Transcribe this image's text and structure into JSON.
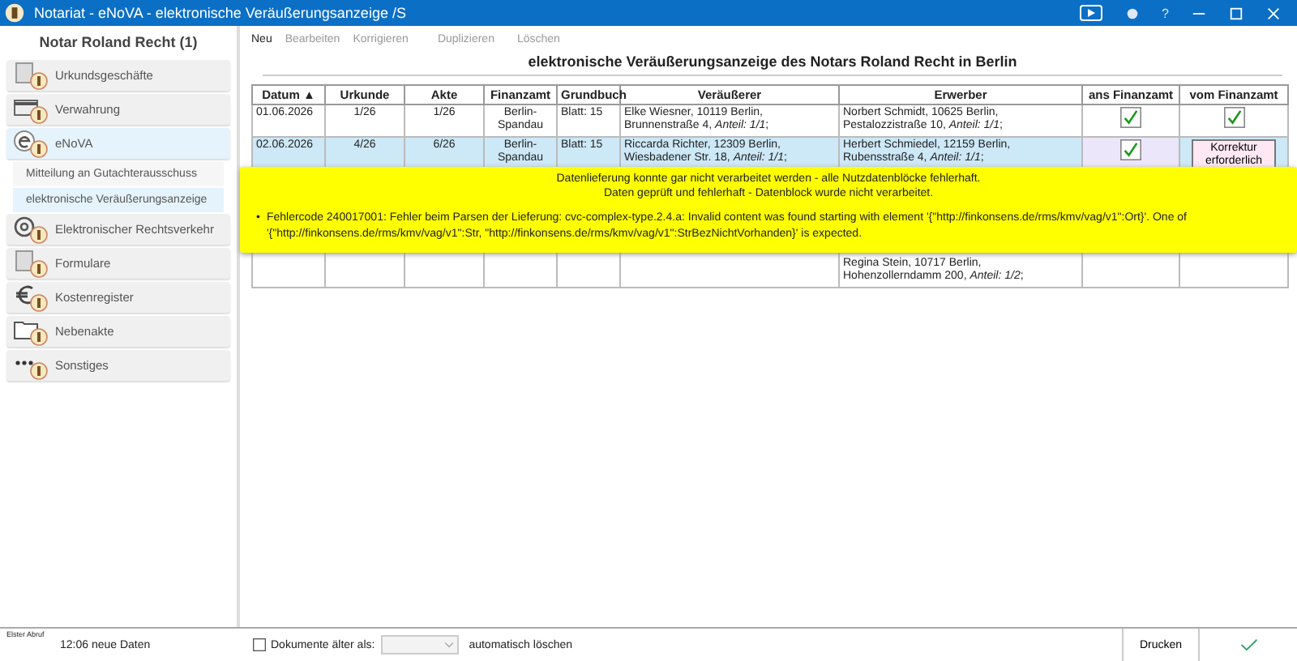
{
  "window": {
    "title": "Notariat - eNoVA - elektronische Veräußerungsanzeige /S",
    "help": "?"
  },
  "sidebar": {
    "header": "Notar Roland Recht (1)",
    "items": [
      {
        "label": "Urkundsgeschäfte",
        "kind": "document",
        "selected": false
      },
      {
        "label": "Verwahrung",
        "kind": "card",
        "selected": false
      },
      {
        "label": "eNoVA",
        "kind": "e",
        "selected": true,
        "children": [
          {
            "label": "Mitteilung an Gutachterausschuss",
            "selected": false
          },
          {
            "label": "elektronische Veräußerungsanzeige",
            "selected": true
          }
        ]
      },
      {
        "label": "Elektronischer Rechtsverkehr",
        "kind": "at",
        "selected": false
      },
      {
        "label": "Formulare",
        "kind": "document",
        "selected": false
      },
      {
        "label": "Kostenregister",
        "kind": "euro",
        "selected": false
      },
      {
        "label": "Nebenakte",
        "kind": "folder",
        "selected": false
      },
      {
        "label": "Sonstiges",
        "kind": "dots",
        "selected": false
      }
    ]
  },
  "toolbar": [
    {
      "label": "Neu",
      "disabled": false
    },
    {
      "label": "Bearbeiten",
      "disabled": true
    },
    {
      "label": "Korrigieren",
      "disabled": true
    },
    {
      "label": "Duplizieren",
      "disabled": true
    },
    {
      "label": "Löschen",
      "disabled": true
    }
  ],
  "main": {
    "title": "elektronische Veräußerungsanzeige des Notars Roland Recht in Berlin"
  },
  "table": {
    "columns": [
      "Datum ▲",
      "Urkunde",
      "Akte",
      "Finanzamt",
      "Grundbuch",
      "Veräußerer",
      "Erwerber",
      "ans Finanzamt",
      "vom Finanzamt"
    ],
    "rows": [
      {
        "selected": false,
        "datum": "01.06.2026",
        "urkunde": "1/26",
        "akte": "1/26",
        "finanzamt": "Berlin-Spandau",
        "grundbuch": "Blatt: 15",
        "veraeusserer": "Elke Wiesner, 10119 Berlin, Brunnenstraße 4, *Anteil: 1/1*;",
        "erwerber": "Norbert Schmidt, 10625 Berlin, Pestalozzistraße 10, *Anteil: 1/1*;",
        "ans_finanzamt": {
          "kind": "check",
          "checked": true
        },
        "vom_finanzamt": {
          "kind": "check",
          "checked": true
        }
      },
      {
        "selected": true,
        "datum": "02.06.2026",
        "urkunde": "4/26",
        "akte": "6/26",
        "finanzamt": "Berlin-Spandau",
        "grundbuch": "Blatt: 15",
        "veraeusserer": "Riccarda Richter, 12309 Berlin, Wiesbadener Str. 18, *Anteil: 1/1*;",
        "erwerber": "Herbert Schmiedel, 12159 Berlin, Rubensstraße 4, *Anteil: 1/1*;",
        "ans_finanzamt": {
          "kind": "check",
          "checked": true
        },
        "vom_finanzamt": {
          "kind": "button",
          "label": "Korrektur erforderlich"
        }
      },
      {
        "selected": false,
        "erwerber": "Regina Stein, 10717 Berlin, Hohenzollerndamm 200, *Anteil: 1/2*;"
      }
    ]
  },
  "error": {
    "lines": [
      "Datenlieferung konnte gar nicht verarbeitet werden - alle Nutzdatenblöcke fehlerhaft.",
      "Daten geprüft und fehlerhaft - Datenblock wurde nicht verarbeitet."
    ],
    "bullet": "•",
    "items": [
      "Fehlercode 240017001: Fehler beim Parsen der Lieferung: cvc-complex-type.2.4.a: Invalid content was found starting with element '{\"http://finkonsens.de/rms/kmv/vag/v1\":Ort}'. One of '{\"http://finkonsens.de/rms/kmv/vag/v1\":Str, \"http://finkonsens.de/rms/kmv/vag/v1\":StrBezNichtVorhanden}' is expected."
    ]
  },
  "status": {
    "caption": "Elster Abruf",
    "info": "12:06 neue Daten",
    "delete_old": {
      "label": "Dokumente älter als:",
      "checked": false
    },
    "auto_delete": "automatisch löschen",
    "print": "Drucken"
  }
}
